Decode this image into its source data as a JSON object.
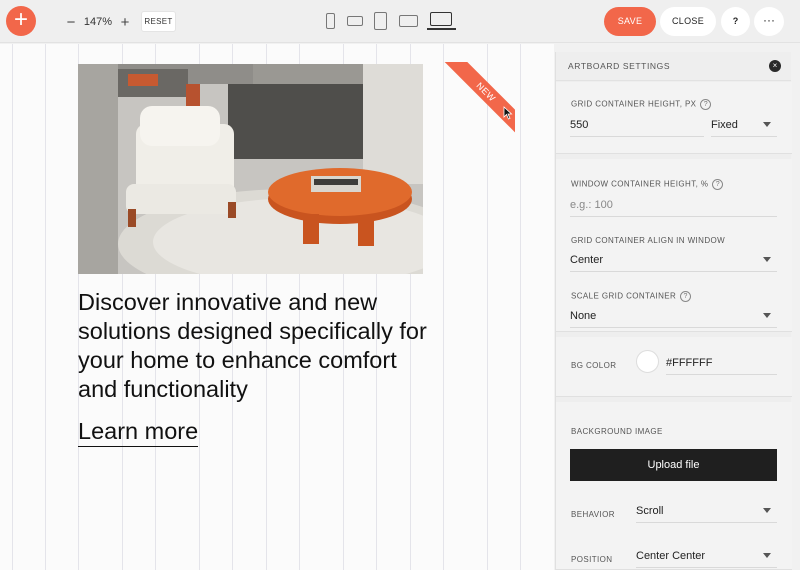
{
  "toolbar": {
    "add_icon": "+",
    "zoom_out_icon": "−",
    "zoom_value": "147%",
    "zoom_in_icon": "+",
    "reset_label": "RESET",
    "devices": [
      "phone-icon",
      "phone-landscape-icon",
      "tablet-icon",
      "tablet-landscape-icon",
      "laptop-icon"
    ],
    "save_label": "SAVE",
    "close_label": "CLOSE",
    "help_label": "?",
    "more_label": "···"
  },
  "canvas": {
    "headline": "Discover innovative and new solutions designed specifically for your home to enhance comfort and functionality",
    "link_text": "Learn more",
    "ribbon_text": "NEW",
    "image_alt": "living room with white armchair and orange table"
  },
  "panel": {
    "title": "ARTBOARD SETTINGS",
    "close_icon": "×",
    "grid_height_label": "GRID CONTAINER HEIGHT, PX",
    "grid_height_value": "550",
    "grid_height_mode": "Fixed",
    "window_height_label": "WINDOW CONTAINER HEIGHT, %",
    "window_height_placeholder": "e.g.: 100",
    "align_label": "GRID CONTAINER ALIGN IN WINDOW",
    "align_value": "Center",
    "scale_label": "SCALE GRID CONTAINER",
    "scale_value": "None",
    "bg_color_label": "BG COLOR",
    "bg_color_value": "#FFFFFF",
    "bg_image_label": "BACKGROUND IMAGE",
    "upload_label": "Upload file",
    "behavior_label": "BEHAVIOR",
    "behavior_value": "Scroll",
    "position_label": "POSITION",
    "position_value": "Center Center",
    "help_icon": "?"
  },
  "colors": {
    "accent": "#f2674a",
    "dark_button": "#1f1f1f",
    "panel_bg": "#f3f3f3"
  }
}
